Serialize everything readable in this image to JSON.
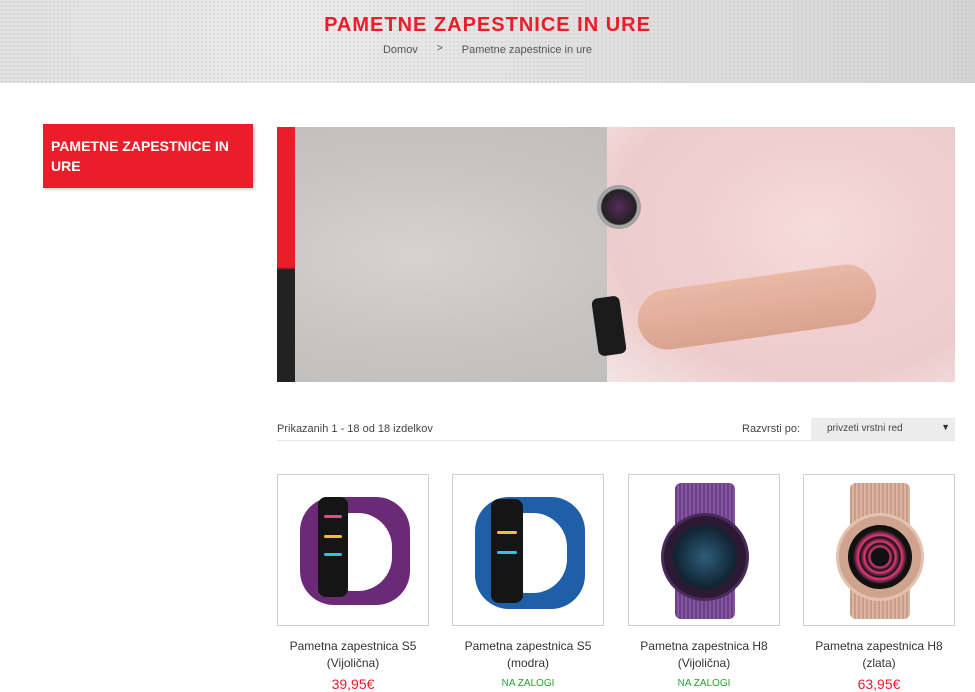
{
  "header": {
    "title": "PAMETNE ZAPESTNICE IN URE",
    "breadcrumb": {
      "home": "Domov",
      "separator": ">",
      "current": "Pametne zapestnice in ure"
    }
  },
  "sidebar": {
    "category": "PAMETNE ZAPESTNICE IN URE"
  },
  "listing": {
    "results_text": "Prikazanih 1 - 18 od 18 izdelkov",
    "sort_label": "Razvrsti po:",
    "sort_value": "privzeti vrstni red",
    "sort_arrow": "▼"
  },
  "products": [
    {
      "name_line1": "Pametna zapestnica S5",
      "name_line2": "(Vijolična)",
      "price": "39,95€",
      "status": ""
    },
    {
      "name_line1": "Pametna zapestnica S5",
      "name_line2": "(modra)",
      "price": "",
      "status": "NA ZALOGI"
    },
    {
      "name_line1": "Pametna zapestnica H8",
      "name_line2": "(Vijolična)",
      "price": "",
      "status": "NA ZALOGI"
    },
    {
      "name_line1": "Pametna zapestnica H8",
      "name_line2": "(zlata)",
      "price": "63,95€",
      "status": ""
    }
  ],
  "colors": {
    "accent": "#ec1c2b",
    "in_stock": "#2aa12a"
  }
}
